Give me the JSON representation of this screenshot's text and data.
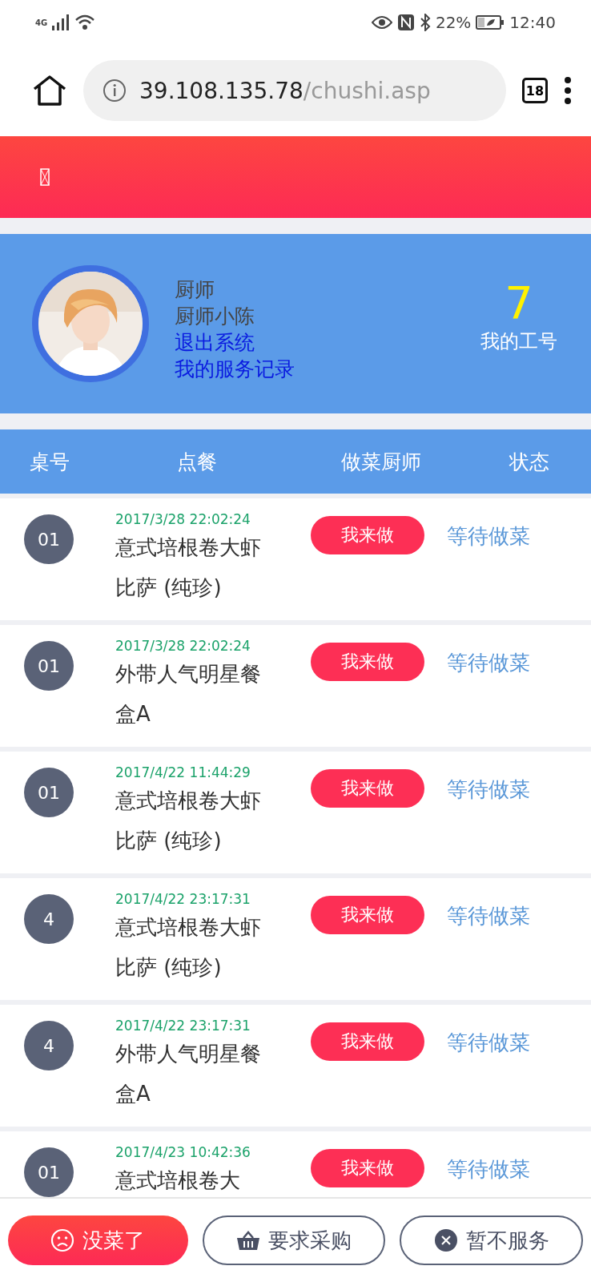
{
  "status_bar": {
    "network": "4G",
    "battery": "22%",
    "time": "12:40"
  },
  "browser": {
    "url_host": "39.108.135.78",
    "url_path": "/chushi.asp",
    "tab_count": "18"
  },
  "profile": {
    "role": "厨师",
    "name": "厨师小陈",
    "logout": "退出系统",
    "records": "我的服务记录",
    "number": "7",
    "number_label": "我的工号"
  },
  "table": {
    "columns": [
      "桌号",
      "点餐",
      "做菜厨师",
      "状态"
    ],
    "rows": [
      {
        "table_no": "01",
        "time": "2017/3/28 22:02:24",
        "dish": "意式培根卷大虾比萨 (纯珍)",
        "action": "我来做",
        "status": "等待做菜"
      },
      {
        "table_no": "01",
        "time": "2017/3/28 22:02:24",
        "dish": "外带人气明星餐盒A",
        "action": "我来做",
        "status": "等待做菜"
      },
      {
        "table_no": "01",
        "time": "2017/4/22 11:44:29",
        "dish": "意式培根卷大虾比萨 (纯珍)",
        "action": "我来做",
        "status": "等待做菜"
      },
      {
        "table_no": "4",
        "time": "2017/4/22 23:17:31",
        "dish": "意式培根卷大虾比萨 (纯珍)",
        "action": "我来做",
        "status": "等待做菜"
      },
      {
        "table_no": "4",
        "time": "2017/4/22 23:17:31",
        "dish": "外带人气明星餐盒A",
        "action": "我来做",
        "status": "等待做菜"
      },
      {
        "table_no": "01",
        "time": "2017/4/23 10:42:36",
        "dish": "意式培根卷大",
        "action": "我来做",
        "status": "等待做菜"
      }
    ]
  },
  "bottom_buttons": [
    {
      "label": "没菜了",
      "kind": "primary"
    },
    {
      "label": "要求采购",
      "kind": "basket"
    },
    {
      "label": "暂不服务",
      "kind": "close"
    }
  ]
}
